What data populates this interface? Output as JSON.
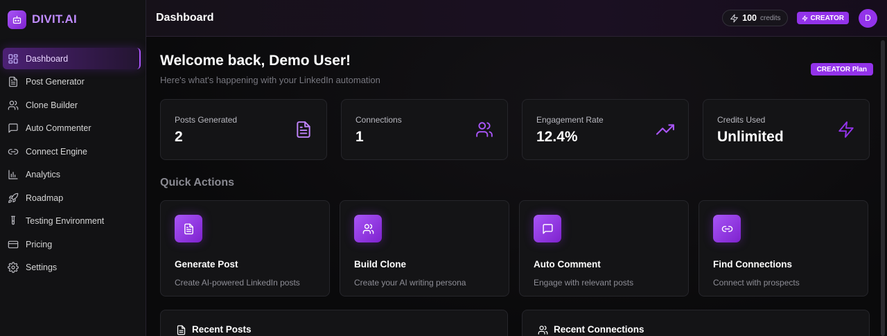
{
  "brand": {
    "name": "DIVIT.AI",
    "logo_icon": "robot-icon"
  },
  "sidebar": {
    "items": [
      {
        "label": "Dashboard",
        "icon": "dashboard-icon",
        "active": true
      },
      {
        "label": "Post Generator",
        "icon": "document-icon"
      },
      {
        "label": "Clone Builder",
        "icon": "users-icon"
      },
      {
        "label": "Auto Commenter",
        "icon": "comment-icon"
      },
      {
        "label": "Connect Engine",
        "icon": "link-icon"
      },
      {
        "label": "Analytics",
        "icon": "bar-chart-icon"
      },
      {
        "label": "Roadmap",
        "icon": "rocket-icon"
      },
      {
        "label": "Testing Environment",
        "icon": "test-tube-icon"
      },
      {
        "label": "Pricing",
        "icon": "credit-card-icon"
      },
      {
        "label": "Settings",
        "icon": "gear-icon"
      }
    ]
  },
  "topbar": {
    "title": "Dashboard",
    "credits_value": "100",
    "credits_label": "credits",
    "tier_badge": "CREATOR",
    "avatar_initial": "D"
  },
  "welcome": {
    "title": "Welcome back, Demo User!",
    "subtitle": "Here's what's happening with your LinkedIn automation",
    "plan_badge": "CREATOR Plan"
  },
  "stats": [
    {
      "label": "Posts Generated",
      "value": "2",
      "icon": "document-icon"
    },
    {
      "label": "Connections",
      "value": "1",
      "icon": "users-icon"
    },
    {
      "label": "Engagement Rate",
      "value": "12.4%",
      "icon": "trending-up-icon"
    },
    {
      "label": "Credits Used",
      "value": "Unlimited",
      "icon": "lightning-icon"
    }
  ],
  "quick_actions": {
    "title": "Quick Actions",
    "items": [
      {
        "title": "Generate Post",
        "desc": "Create AI-powered LinkedIn posts",
        "icon": "document-icon"
      },
      {
        "title": "Build Clone",
        "desc": "Create your AI writing persona",
        "icon": "users-icon"
      },
      {
        "title": "Auto Comment",
        "desc": "Engage with relevant posts",
        "icon": "comment-icon"
      },
      {
        "title": "Find Connections",
        "desc": "Connect with prospects",
        "icon": "link-icon"
      }
    ]
  },
  "panels": {
    "recent_posts": "Recent Posts",
    "recent_connections": "Recent Connections"
  },
  "colors": {
    "accent": "#9333ea",
    "accent_light": "#a855f7",
    "background": "#0b0b0d"
  }
}
